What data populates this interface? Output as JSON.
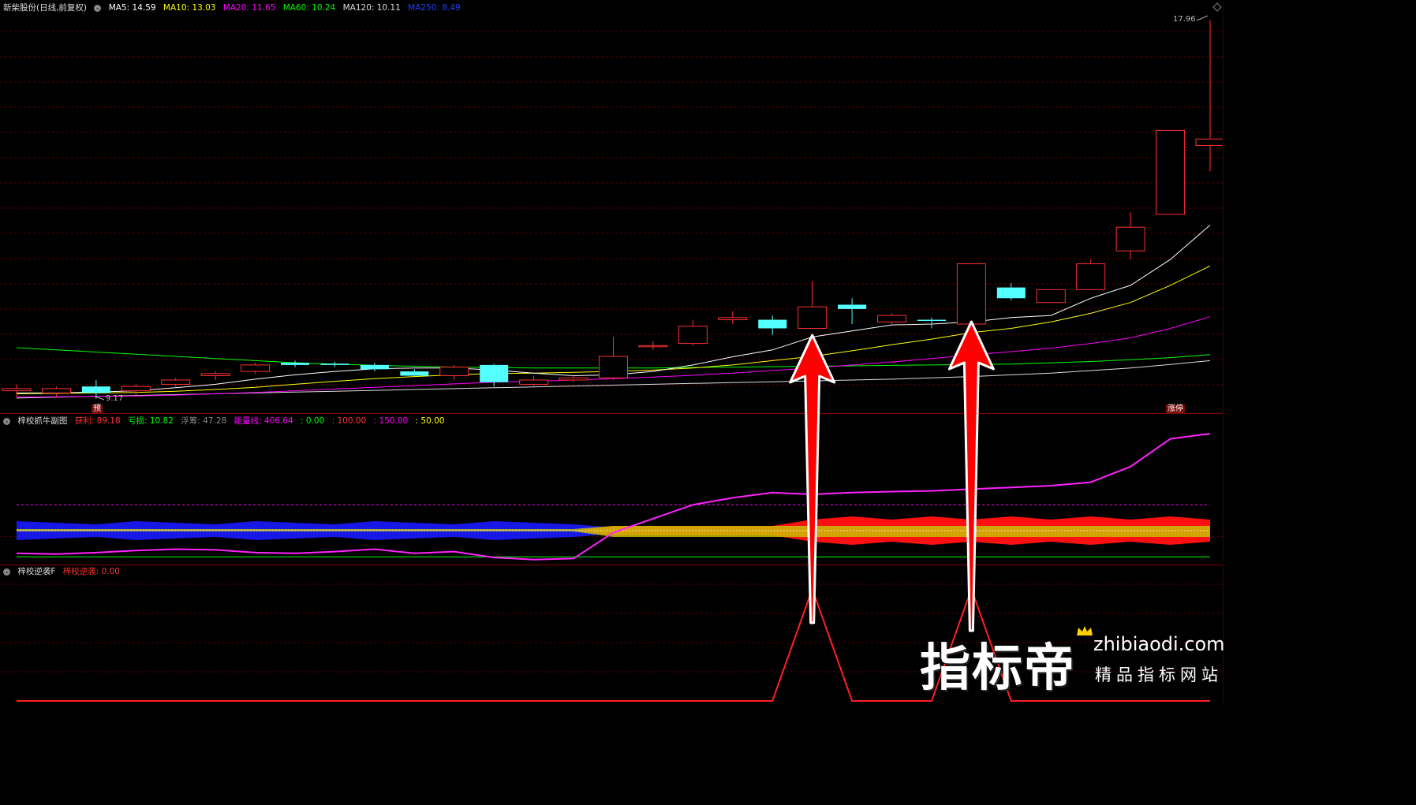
{
  "main_header": {
    "title": "新柴股份(日线,前复权)",
    "ma5": "MA5: 14.59",
    "ma10": "MA10: 13.03",
    "ma20": "MA20: 11.65",
    "ma60": "MA60: 10.24",
    "ma120": "MA120: 10.11",
    "ma250": "MA250: 8.49"
  },
  "main_labels": {
    "high_price": "17.96",
    "low_price": "9.17",
    "left_tag": "预",
    "right_tag": "涨停"
  },
  "sub1_header": {
    "title": "梓校抓牛副图",
    "profit": "获利: 89.18",
    "loss": "亏损: 10.82",
    "float": "浮筹: 47.28",
    "energy": "能量线: 406.64",
    "v0": ": 0.00",
    "v100": ": 100.00",
    "v150": ": 150.00",
    "v50": ": 50.00"
  },
  "sub2_header": {
    "title": "梓校逆袭F",
    "value": "梓校逆袭: 0.00"
  },
  "watermark": {
    "brand": "指标帝",
    "url": "zhibiaodi.com",
    "slogan": "精品指标网站"
  },
  "colors": {
    "up": "#ff3030",
    "down": "#54ffff",
    "ma5": "#ffffff",
    "ma10": "#ffff00",
    "ma20": "#ff00ff",
    "ma60": "#00ff00",
    "ma120": "#dddddd",
    "ma250": "#2040ff",
    "grid": "#5a0000"
  },
  "chart_data": {
    "type": "candlestick",
    "candles": [
      {
        "o": 9.35,
        "h": 9.5,
        "l": 9.2,
        "c": 9.4
      },
      {
        "o": 9.3,
        "h": 9.45,
        "l": 9.2,
        "c": 9.4
      },
      {
        "o": 9.45,
        "h": 9.6,
        "l": 9.17,
        "c": 9.3
      },
      {
        "o": 9.35,
        "h": 9.5,
        "l": 9.25,
        "c": 9.45
      },
      {
        "o": 9.5,
        "h": 9.65,
        "l": 9.45,
        "c": 9.6
      },
      {
        "o": 9.7,
        "h": 9.8,
        "l": 9.6,
        "c": 9.75
      },
      {
        "o": 9.8,
        "h": 10.0,
        "l": 9.75,
        "c": 9.95
      },
      {
        "o": 10.0,
        "h": 10.05,
        "l": 9.9,
        "c": 9.95
      },
      {
        "o": 9.98,
        "h": 10.02,
        "l": 9.9,
        "c": 9.95
      },
      {
        "o": 9.95,
        "h": 10.0,
        "l": 9.8,
        "c": 9.85
      },
      {
        "o": 9.8,
        "h": 9.85,
        "l": 9.7,
        "c": 9.7
      },
      {
        "o": 9.7,
        "h": 9.95,
        "l": 9.6,
        "c": 9.9
      },
      {
        "o": 9.95,
        "h": 9.98,
        "l": 9.45,
        "c": 9.55
      },
      {
        "o": 9.5,
        "h": 9.7,
        "l": 9.45,
        "c": 9.6
      },
      {
        "o": 9.6,
        "h": 9.7,
        "l": 9.55,
        "c": 9.65
      },
      {
        "o": 9.65,
        "h": 10.6,
        "l": 9.6,
        "c": 10.15
      },
      {
        "o": 10.4,
        "h": 10.5,
        "l": 10.3,
        "c": 10.4
      },
      {
        "o": 10.45,
        "h": 11.0,
        "l": 10.4,
        "c": 10.85
      },
      {
        "o": 11.0,
        "h": 11.2,
        "l": 10.9,
        "c": 11.05
      },
      {
        "o": 11.0,
        "h": 11.1,
        "l": 10.65,
        "c": 10.8
      },
      {
        "o": 10.8,
        "h": 11.9,
        "l": 10.8,
        "c": 11.3
      },
      {
        "o": 11.35,
        "h": 11.5,
        "l": 10.9,
        "c": 11.25
      },
      {
        "o": 10.95,
        "h": 11.15,
        "l": 10.85,
        "c": 11.1
      },
      {
        "o": 11.0,
        "h": 11.05,
        "l": 10.8,
        "c": 10.98
      },
      {
        "o": 10.9,
        "h": 12.3,
        "l": 10.9,
        "c": 12.3
      },
      {
        "o": 11.75,
        "h": 11.85,
        "l": 11.45,
        "c": 11.5
      },
      {
        "o": 11.4,
        "h": 11.7,
        "l": 11.4,
        "c": 11.7
      },
      {
        "o": 11.7,
        "h": 12.4,
        "l": 11.7,
        "c": 12.3
      },
      {
        "o": 12.6,
        "h": 13.5,
        "l": 12.4,
        "c": 13.15
      },
      {
        "o": 13.45,
        "h": 15.4,
        "l": 13.45,
        "c": 15.4
      },
      {
        "o": 15.05,
        "h": 17.96,
        "l": 14.45,
        "c": 15.2
      }
    ],
    "ma5": [
      9.3,
      9.3,
      9.32,
      9.35,
      9.42,
      9.5,
      9.62,
      9.72,
      9.8,
      9.86,
      9.88,
      9.88,
      9.83,
      9.76,
      9.7,
      9.72,
      9.8,
      9.95,
      10.14,
      10.3,
      10.6,
      10.74,
      10.88,
      10.9,
      10.95,
      11.05,
      11.1,
      11.5,
      11.8,
      12.4,
      13.2
    ],
    "ma10": [
      9.28,
      9.29,
      9.3,
      9.31,
      9.34,
      9.38,
      9.43,
      9.5,
      9.57,
      9.63,
      9.68,
      9.72,
      9.75,
      9.76,
      9.78,
      9.8,
      9.83,
      9.88,
      9.95,
      10.05,
      10.15,
      10.28,
      10.42,
      10.55,
      10.7,
      10.8,
      10.95,
      11.15,
      11.4,
      11.8,
      12.25
    ],
    "ma20": [
      9.2,
      9.21,
      9.22,
      9.23,
      9.25,
      9.28,
      9.31,
      9.35,
      9.39,
      9.43,
      9.47,
      9.51,
      9.55,
      9.57,
      9.6,
      9.63,
      9.67,
      9.71,
      9.76,
      9.82,
      9.88,
      9.95,
      10.02,
      10.1,
      10.18,
      10.26,
      10.34,
      10.45,
      10.58,
      10.8,
      11.07
    ],
    "ma60": [
      10.35,
      10.3,
      10.25,
      10.2,
      10.15,
      10.1,
      10.05,
      10.0,
      9.97,
      9.94,
      9.92,
      9.9,
      9.89,
      9.88,
      9.88,
      9.88,
      9.88,
      9.89,
      9.9,
      9.91,
      9.92,
      9.93,
      9.94,
      9.95,
      9.96,
      9.97,
      10.0,
      10.03,
      10.07,
      10.12,
      10.19
    ],
    "ma120": [
      9.18,
      9.2,
      9.22,
      9.24,
      9.26,
      9.28,
      9.3,
      9.32,
      9.34,
      9.36,
      9.38,
      9.4,
      9.42,
      9.44,
      9.46,
      9.48,
      9.5,
      9.52,
      9.54,
      9.56,
      9.58,
      9.6,
      9.62,
      9.65,
      9.68,
      9.72,
      9.76,
      9.82,
      9.88,
      9.96,
      10.05
    ],
    "sub1": {
      "energy": [
        10,
        8,
        12,
        18,
        22,
        20,
        12,
        10,
        15,
        22,
        10,
        15,
        -2,
        -8,
        -5,
        70,
        110,
        150,
        170,
        185,
        180,
        185,
        188,
        190,
        195,
        200,
        205,
        215,
        260,
        340,
        355
      ],
      "ref_lines": [
        0,
        100,
        150,
        50
      ]
    },
    "sub2": {
      "signal": [
        0,
        0,
        0,
        0,
        0,
        0,
        0,
        0,
        0,
        0,
        0,
        0,
        0,
        0,
        0,
        0,
        0,
        0,
        0,
        0,
        1,
        0,
        0,
        0,
        1,
        0,
        0,
        0,
        0,
        0,
        0
      ]
    }
  }
}
